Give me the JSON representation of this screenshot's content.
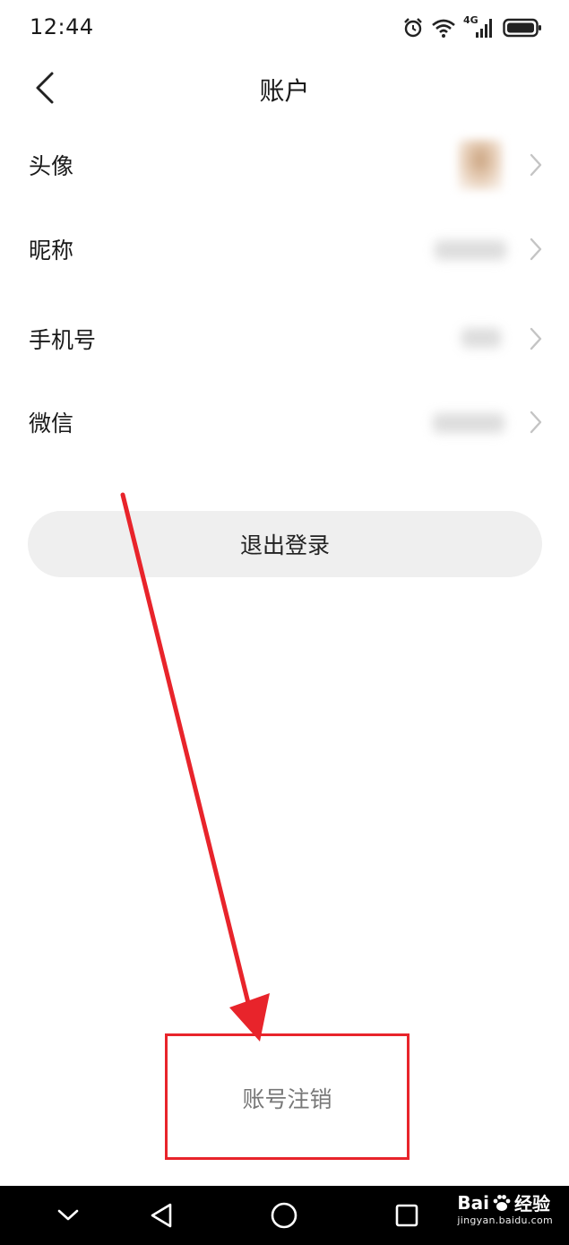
{
  "status_bar": {
    "time": "12:44",
    "network": "4G",
    "icons": [
      "alarm-icon",
      "wifi-icon",
      "signal-icon",
      "battery-icon"
    ]
  },
  "header": {
    "title": "账户",
    "back_icon": "chevron-left-icon"
  },
  "rows": [
    {
      "label": "头像"
    },
    {
      "label": "昵称"
    },
    {
      "label": "手机号"
    },
    {
      "label": "微信"
    }
  ],
  "logout_label": "退出登录",
  "cancel_account_label": "账号注销",
  "annotation": {
    "color": "#e8242b"
  },
  "system_nav": {
    "buttons": [
      "chevron-down-icon",
      "back-triangle-icon",
      "home-circle-icon",
      "recents-square-icon"
    ]
  },
  "watermark": {
    "brand_left": "Bai",
    "brand_right": "经验",
    "url": "jingyan.baidu.com"
  }
}
